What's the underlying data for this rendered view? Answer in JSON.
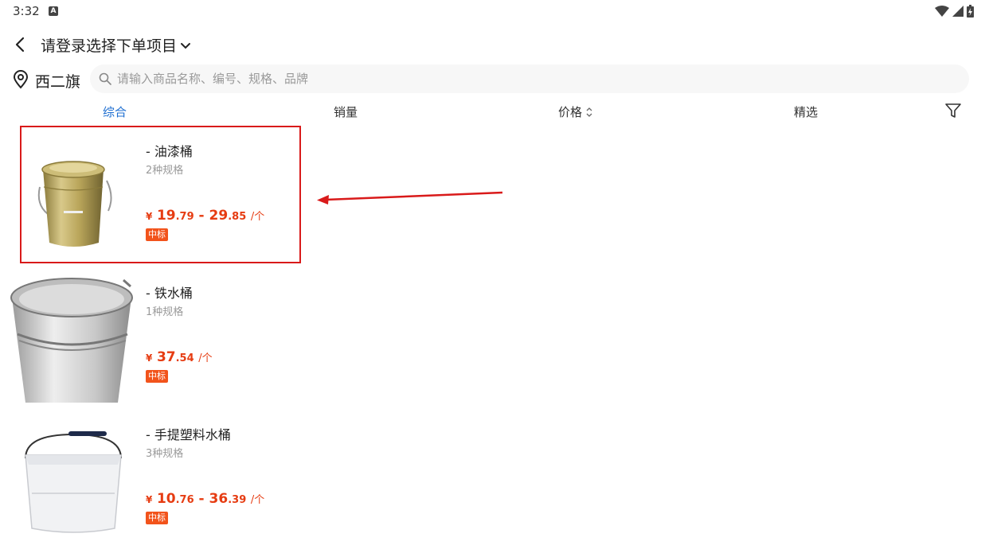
{
  "status_bar": {
    "time": "3:32",
    "notification_glyph": "A"
  },
  "header": {
    "title": "请登录选择下单项目"
  },
  "location": {
    "name": "西二旗"
  },
  "search": {
    "placeholder": "请输入商品名称、编号、规格、品牌"
  },
  "tabs": [
    {
      "label": "综合",
      "active": true
    },
    {
      "label": "销量",
      "active": false
    },
    {
      "label": "价格",
      "active": false
    },
    {
      "label": "精选",
      "active": false
    }
  ],
  "products": [
    {
      "name": "- 油漆桶",
      "spec": "2种规格",
      "price": {
        "yen": "¥",
        "min_int": "19",
        "min_dec": ".79",
        "sep": " - ",
        "max_int": "29",
        "max_dec": ".85",
        "unit": "/个"
      },
      "badge": "中标"
    },
    {
      "name": "- 铁水桶",
      "spec": "1种规格",
      "price": {
        "yen": "¥",
        "min_int": "37",
        "min_dec": ".54",
        "unit": "/个"
      },
      "badge": "中标"
    },
    {
      "name": "- 手提塑料水桶",
      "spec": "3种规格",
      "price": {
        "yen": "¥",
        "min_int": "10",
        "min_dec": ".76",
        "sep": " - ",
        "max_int": "36",
        "max_dec": ".39",
        "unit": "/个"
      },
      "badge": "中标"
    }
  ],
  "colors": {
    "accent": "#1f6fd1",
    "price": "#e63c12",
    "badge": "#f2531b",
    "annotation": "#d91a1a"
  }
}
